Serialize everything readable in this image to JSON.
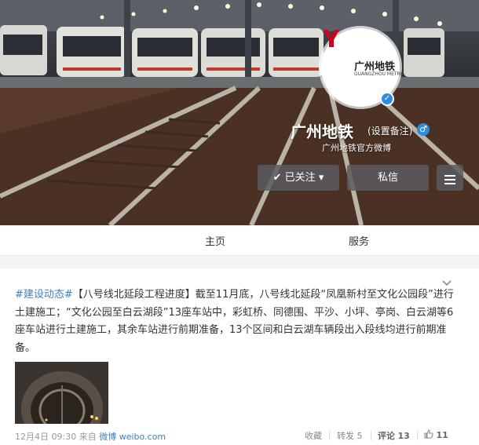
{
  "profile": {
    "logo_text": "广州地铁",
    "logo_subtext": "GUANGZHOU METRO",
    "name": "广州地铁",
    "remark_link": "(设置备注)",
    "gender_symbol": "♂",
    "bio": "广州地铁官方微博",
    "verified_symbol": "✓"
  },
  "buttons": {
    "follow": "✔ 已关注 ▾",
    "message": "私信"
  },
  "tabs": {
    "home": "主页",
    "service": "服务"
  },
  "post": {
    "topic": "#建设动态#",
    "text": "【八号线北延段工程进度】截至11月底，八号线北延段“凤凰新村至文化公园段”进行土建施工；“文化公园至白云湖段”13座车站中，彩虹桥、同德围、平沙、小坪、亭岗、白云湖等6座车站进行土建施工，其余车站进行前期准备，13个区间和白云湖车辆段出入段线均进行前期准备。",
    "time": "12月4日 09:30",
    "from_label": "来自",
    "source": "微博 weibo.com",
    "actions": {
      "favorite": "收藏",
      "repost_label": "转发",
      "repost_count": "5",
      "comment_label": "评论",
      "comment_count": "13",
      "like_count": "11"
    }
  },
  "colors": {
    "link": "#3f7fbf",
    "verified": "#2c8ce3",
    "logo_red": "#d0021b"
  }
}
